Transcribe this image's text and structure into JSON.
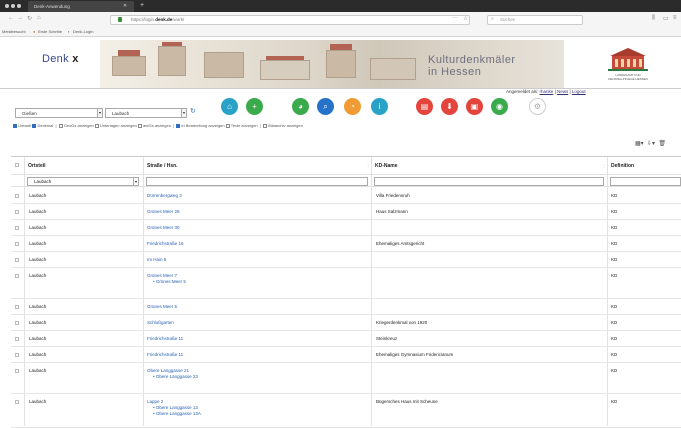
{
  "browser": {
    "tab_title": "Denk-Anwendung",
    "url_prefix": "https://login.",
    "url_host": "denk.de",
    "url_path": "/work/",
    "search_placeholder": "Suchen",
    "bookmarks": [
      "Meistbesucht",
      "Erste Schritte",
      "Denk-Login"
    ]
  },
  "banner": {
    "logo_text": "Denk",
    "logo_mark": "x",
    "title_line1": "Kulturdenkmäler",
    "title_line2": "in Hessen",
    "partner_line1": "LANDESAMT FÜR",
    "partner_line2": "DENKMALPFLEGE HESSEN"
  },
  "login": {
    "prefix": "Angemeldet als:",
    "user": "rhanke",
    "news": "News",
    "logout": "Logout"
  },
  "toolbar": {
    "select1": "Gießen",
    "select2": "Laubach",
    "refresh_icon": "refresh-icon",
    "filters": [
      {
        "label": "Umwelt",
        "checked": true
      },
      {
        "label": "Denkmal",
        "checked": true
      },
      {
        "label": "GeoGs anzeigen",
        "checked": false
      },
      {
        "label": "Unterlagen anzeigen",
        "checked": false
      },
      {
        "label": "antGs anzeigen",
        "checked": false
      },
      {
        "label": "in Bearbeitung anzeigen",
        "checked": true
      },
      {
        "label": "Texte anzeigen",
        "checked": false
      },
      {
        "label": "Bildarchiv anzeigen",
        "checked": false
      }
    ],
    "colors": {
      "teal": "#2aa1c7",
      "green": "#3aab4c",
      "blue": "#2473c9",
      "orange": "#f09b34",
      "red": "#e3453c",
      "grey": "#cfcfcf"
    }
  },
  "table": {
    "headers": [
      "Ortsteil",
      "Straße / Hsn.",
      "KD-Name",
      "Definition"
    ],
    "filter_value": "Laubach",
    "rows": [
      {
        "ortsteil": "Laubach",
        "strasse": "Dürrenbergweg 3",
        "subs": [],
        "kdname": "Villa Friedensruh",
        "definition": "KD"
      },
      {
        "ortsteil": "Laubach",
        "strasse": "Grünes Meer 28",
        "subs": [],
        "kdname": "Haus Salzmann",
        "definition": "KD"
      },
      {
        "ortsteil": "Laubach",
        "strasse": "Grünes Meer 30",
        "subs": [],
        "kdname": "",
        "definition": "KD"
      },
      {
        "ortsteil": "Laubach",
        "strasse": "Friedrichstraße 16",
        "subs": [],
        "kdname": "Ehemaliges Amtsgericht",
        "definition": "KD"
      },
      {
        "ortsteil": "Laubach",
        "strasse": "Im Hain 8",
        "subs": [],
        "kdname": "",
        "definition": "KD"
      },
      {
        "ortsteil": "Laubach",
        "strasse": "Grünes Meer 7",
        "subs": [
          "Grünes Meer 5"
        ],
        "kdname": "",
        "definition": "KD"
      },
      {
        "ortsteil": "Laubach",
        "strasse": "Grünes Meer 5",
        "subs": [],
        "kdname": "",
        "definition": "KD"
      },
      {
        "ortsteil": "Laubach",
        "strasse": "Schloßgarten",
        "subs": [],
        "kdname": "Kriegerdenkmal von 1920",
        "definition": "KD"
      },
      {
        "ortsteil": "Laubach",
        "strasse": "Friedrichstraße 11",
        "subs": [],
        "kdname": "Steinkreuz",
        "definition": "KD"
      },
      {
        "ortsteil": "Laubach",
        "strasse": "Friedrichstraße 11",
        "subs": [],
        "kdname": "Ehemaliges Gymnasium Fridericianum",
        "definition": "KD"
      },
      {
        "ortsteil": "Laubach",
        "strasse": "Obere Langgasse 21",
        "subs": [
          "Obere Langgasse 23"
        ],
        "kdname": "",
        "definition": "KD"
      },
      {
        "ortsteil": "Laubach",
        "strasse": "Lappe 2",
        "subs": [
          "Obere Langgasse 13",
          "Obere Langgasse 13A"
        ],
        "kdname": "Bügersches Haus mit Scheune",
        "definition": "KD"
      }
    ]
  }
}
